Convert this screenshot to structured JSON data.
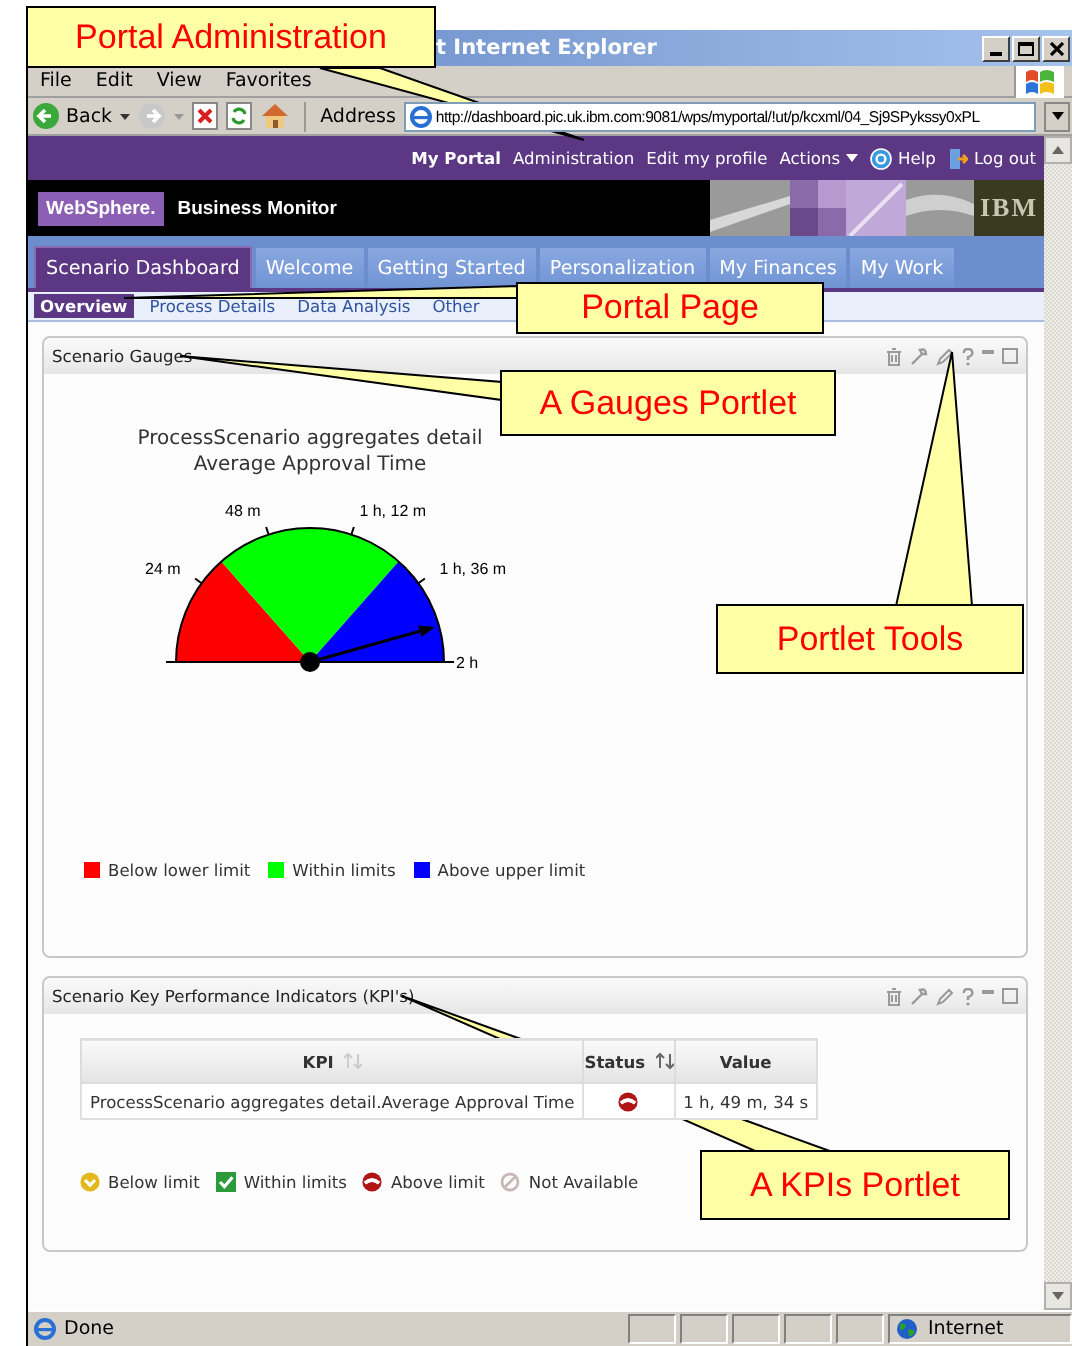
{
  "browser": {
    "title": "t Internet Explorer",
    "menu": [
      "File",
      "Edit",
      "View",
      "Favorites"
    ],
    "back_label": "Back",
    "address_label": "Address",
    "address": "http://dashboard.pic.uk.ibm.com:9081/wps/myportal/!ut/p/kcxml/04_Sj9SPykssy0xPL",
    "status": "Done",
    "zone": "Internet"
  },
  "portal_links": [
    {
      "kind": "strong",
      "label": "My Portal"
    },
    {
      "kind": "link",
      "label": "Administration"
    },
    {
      "kind": "link",
      "label": "Edit my profile"
    },
    {
      "kind": "menu",
      "label": "Actions"
    },
    {
      "kind": "help",
      "label": "Help"
    },
    {
      "kind": "logout",
      "label": "Log out"
    }
  ],
  "banner": {
    "badge": "WebSphere.",
    "product": "Business Monitor",
    "brand": "IBM"
  },
  "tabs": [
    {
      "label": "Scenario Dashboard",
      "selected": true
    },
    {
      "label": "Welcome",
      "selected": false
    },
    {
      "label": "Getting Started",
      "selected": false
    },
    {
      "label": "Personalization",
      "selected": false
    },
    {
      "label": "My Finances",
      "selected": false
    },
    {
      "label": "My Work",
      "selected": false
    }
  ],
  "subtabs": [
    {
      "label": "Overview",
      "selected": true
    },
    {
      "label": "Process Details",
      "selected": false
    },
    {
      "label": "Data Analysis",
      "selected": false
    },
    {
      "label": "Other",
      "selected": false
    }
  ],
  "gauges_portlet": {
    "title": "Scenario Gauges",
    "chart_title": [
      "ProcessScenario aggregates detail",
      "Average Approval Time"
    ],
    "ticks": [
      "24 m",
      "48 m",
      "1 h, 12 m",
      "1 h, 36 m",
      "2 h"
    ],
    "zones": [
      {
        "label": "Below lower limit",
        "color": "#ff0000"
      },
      {
        "label": "Within limits",
        "color": "#00ff00"
      },
      {
        "label": "Above upper limit",
        "color": "#0000ff"
      }
    ]
  },
  "kpi_portlet": {
    "title": "Scenario Key Performance Indicators (KPI's)",
    "columns": [
      "KPI",
      "Status",
      "Value"
    ],
    "rows": [
      {
        "kpi": "ProcessScenario aggregates detail.Average Approval Time",
        "status": {
          "kind": "above"
        },
        "value": "1 h, 49 m, 34 s"
      }
    ],
    "legend": [
      {
        "kind": "below",
        "label": "Below limit"
      },
      {
        "kind": "within",
        "label": "Within limits"
      },
      {
        "kind": "above",
        "label": "Above limit"
      },
      {
        "kind": "not_available",
        "label": "Not Available"
      }
    ]
  },
  "callouts": [
    {
      "text": "Portal Administration"
    },
    {
      "text": "Portal Page"
    },
    {
      "text": "A Gauges Portlet"
    },
    {
      "text": "Portlet Tools"
    },
    {
      "text": "A KPIs Portlet"
    }
  ]
}
